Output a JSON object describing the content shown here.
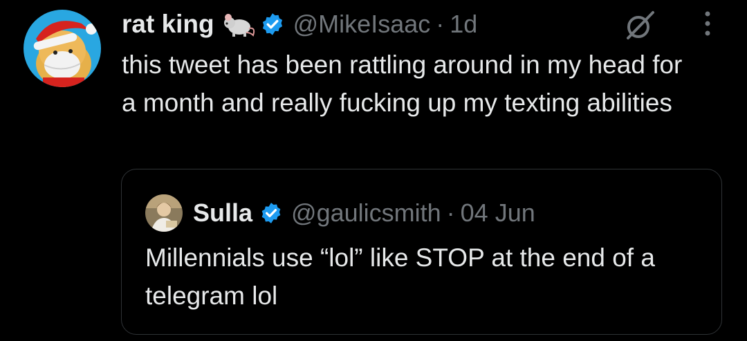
{
  "tweet": {
    "author_name": "rat king",
    "author_emoji": "rat-emoji",
    "handle": "@MikeIsaac",
    "separator": "·",
    "time": "1d",
    "text": "this tweet has been rattling around in my head for a month and really fucking up my texting abilities"
  },
  "quoted_tweet": {
    "author_name": "Sulla",
    "handle": "@gaulicsmith",
    "separator": "·",
    "time": "04 Jun",
    "text": "Millennials use “lol” like STOP at the end of a telegram lol"
  },
  "icons": {
    "verified": "verified-badge-icon",
    "grok": "grok-icon",
    "more": "more-options-icon"
  },
  "colors": {
    "background": "#000000",
    "text": "#e7e9ea",
    "secondary": "#71767b",
    "verified_blue": "#1d9bf0",
    "border": "#2f3336"
  }
}
